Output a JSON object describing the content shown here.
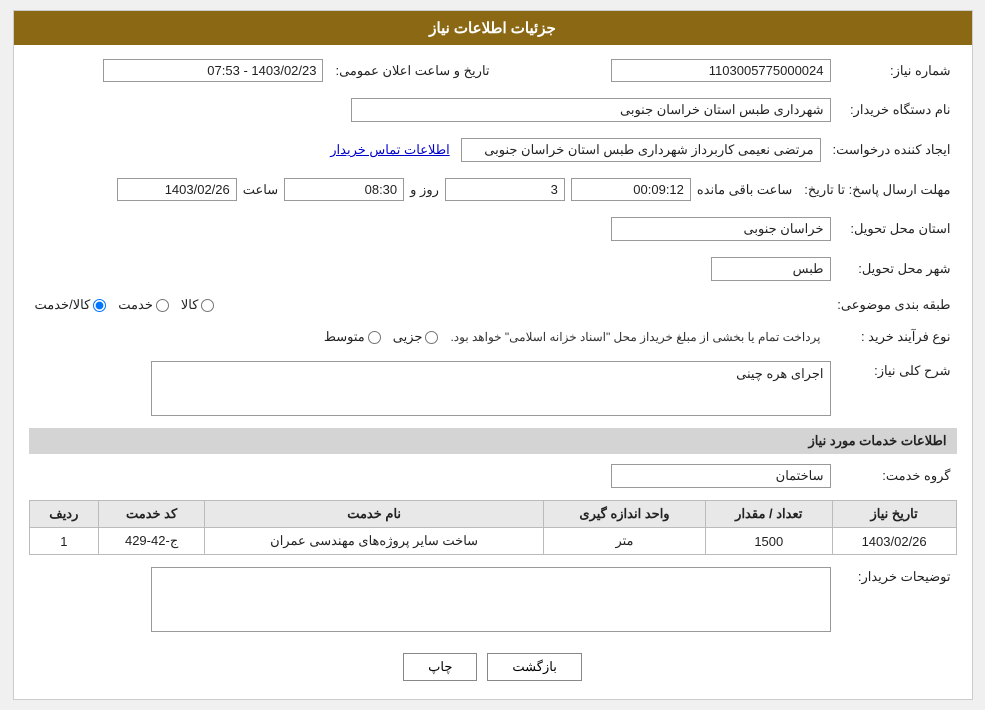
{
  "page": {
    "title": "جزئیات اطلاعات نیاز"
  },
  "header": {
    "label_shomara": "شماره نیاز:",
    "value_shomara": "1103005775000024",
    "label_tarikh": "تاریخ و ساعت اعلان عمومی:",
    "value_tarikh": "1403/02/23 - 07:53",
    "label_nam_dastgah": "نام دستگاه خریدار:",
    "value_nam_dastgah": "شهرداری طبس استان خراسان جنوبی",
    "label_ijad_konande": "ایجاد کننده درخواست:",
    "value_ijad_konande": "مرتضی نعیمی کاربرداز شهرداری طبس استان خراسان جنوبی",
    "link_ittila": "اطلاعات تماس خریدار",
    "label_mohlat": "مهلت ارسال پاسخ: تا تاریخ:",
    "value_date": "1403/02/26",
    "value_saat": "08:30",
    "value_rooz": "3",
    "value_baqi": "00:09:12",
    "label_saat": "ساعت",
    "label_rooz_va": "روز و",
    "label_saat_baqi": "ساعت باقی مانده",
    "label_ostan": "استان محل تحویل:",
    "value_ostan": "خراسان جنوبی",
    "label_shahr": "شهر محل تحویل:",
    "value_shahr": "طبس",
    "label_tabaqe": "طبقه بندی موضوعی:",
    "radio_kala": "کالا",
    "radio_khedmat": "خدمت",
    "radio_kala_khedmat": "کالا/خدمت",
    "radio_kala_checked": false,
    "radio_khedmat_checked": false,
    "radio_kala_khedmat_checked": true,
    "label_nooe_farayand": "نوع فرآیند خرید :",
    "radio_jozii": "جزیی",
    "radio_motavasset": "متوسط",
    "notice_farayand": "پرداخت تمام یا بخشی از مبلغ خریداز محل \"اسناد خزانه اسلامی\" خواهد بود.",
    "label_sharh": "شرح کلی نیاز:",
    "value_sharh": "اجرای هره چینی",
    "section_khadamat": "اطلاعات خدمات مورد نیاز",
    "label_gorooh": "گروه خدمت:",
    "value_gorooh": "ساختمان",
    "table_headers": {
      "radif": "ردیف",
      "kod_khedmat": "کد خدمت",
      "nam_khedmat": "نام خدمت",
      "vahed": "واحد اندازه گیری",
      "tedad": "تعداد / مقدار",
      "tarikh": "تاریخ نیاز"
    },
    "table_rows": [
      {
        "radif": "1",
        "kod_khedmat": "ج-42-429",
        "nam_khedmat": "ساخت سایر پروژه‌های مهندسی عمران",
        "vahed": "متر",
        "tedad": "1500",
        "tarikh": "1403/02/26"
      }
    ],
    "label_tawzih": "توضیحات خریدار:",
    "value_tawzih": "",
    "btn_chap": "چاپ",
    "btn_bazgasht": "بازگشت"
  }
}
